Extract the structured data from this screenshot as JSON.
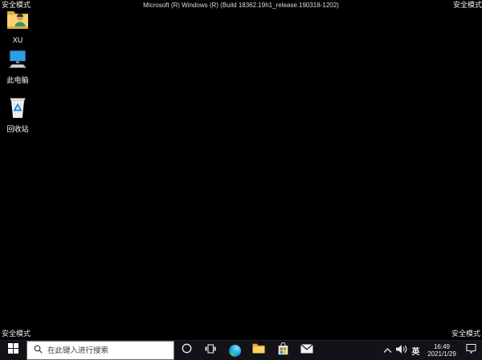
{
  "safe_mode_label": "安全模式",
  "build_text": "Microsoft (R) Windows (R) (Build 18362.19h1_release.190318-1202)",
  "desktop": {
    "background_color": "#000000",
    "icons": [
      {
        "icon": "user-folder-icon",
        "label": "XU"
      },
      {
        "icon": "this-pc-icon",
        "label": "此电脑"
      },
      {
        "icon": "recycle-bin-icon",
        "label": "回收站"
      }
    ]
  },
  "taskbar": {
    "background_color": "#121318",
    "start_icon": "windows-start-icon",
    "search_placeholder": "在此键入进行搜索",
    "search_icon": "search-icon",
    "app_icons": [
      "cortana-icon",
      "task-view-icon",
      "edge-icon",
      "file-explorer-icon",
      "store-icon",
      "mail-icon"
    ],
    "tray": {
      "icons": [
        "chevron-up-icon",
        "volume-icon",
        "action-center-icon"
      ],
      "ime_label": "英",
      "time": "16:49",
      "date": "2021/1/29"
    }
  },
  "colors": {
    "store_red": "#f25022",
    "store_green": "#7fba00",
    "store_blue": "#00a4ef",
    "store_yellow": "#ffb900",
    "folder_yellow": "#f9d26d",
    "screen_blue": "#2f9de4",
    "recycle_blue": "#1f7dd4"
  }
}
